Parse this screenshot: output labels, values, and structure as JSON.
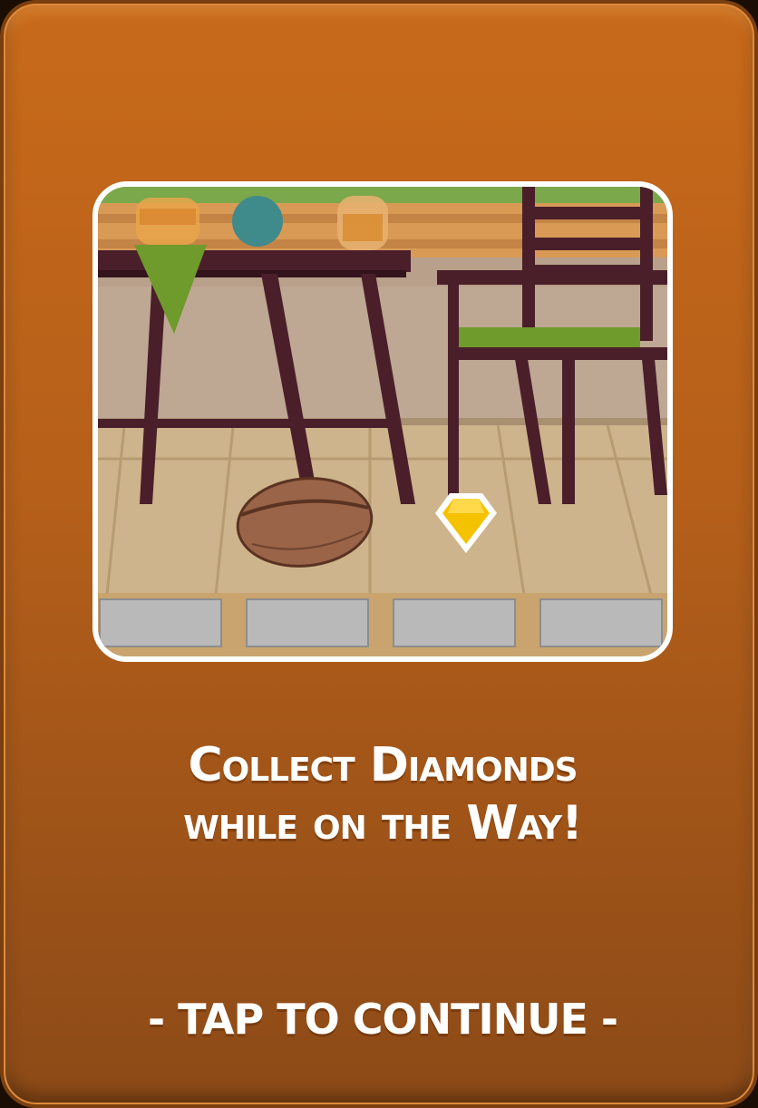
{
  "tutorial": {
    "title_line1": "Collect Diamonds",
    "title_line2": "while on the Way!",
    "tap_prompt": "- TAP TO CONTINUE -"
  },
  "scene": {
    "items": [
      "table",
      "chair",
      "coffee-bean",
      "diamond",
      "stone-tiles"
    ],
    "colors": {
      "card": "#c86a1a",
      "frame": "#ffffff",
      "furniture": "#4a1f2a",
      "cushion": "#6f9a2c",
      "diamond": "#f5c200",
      "floor": "#cdb48c"
    }
  }
}
